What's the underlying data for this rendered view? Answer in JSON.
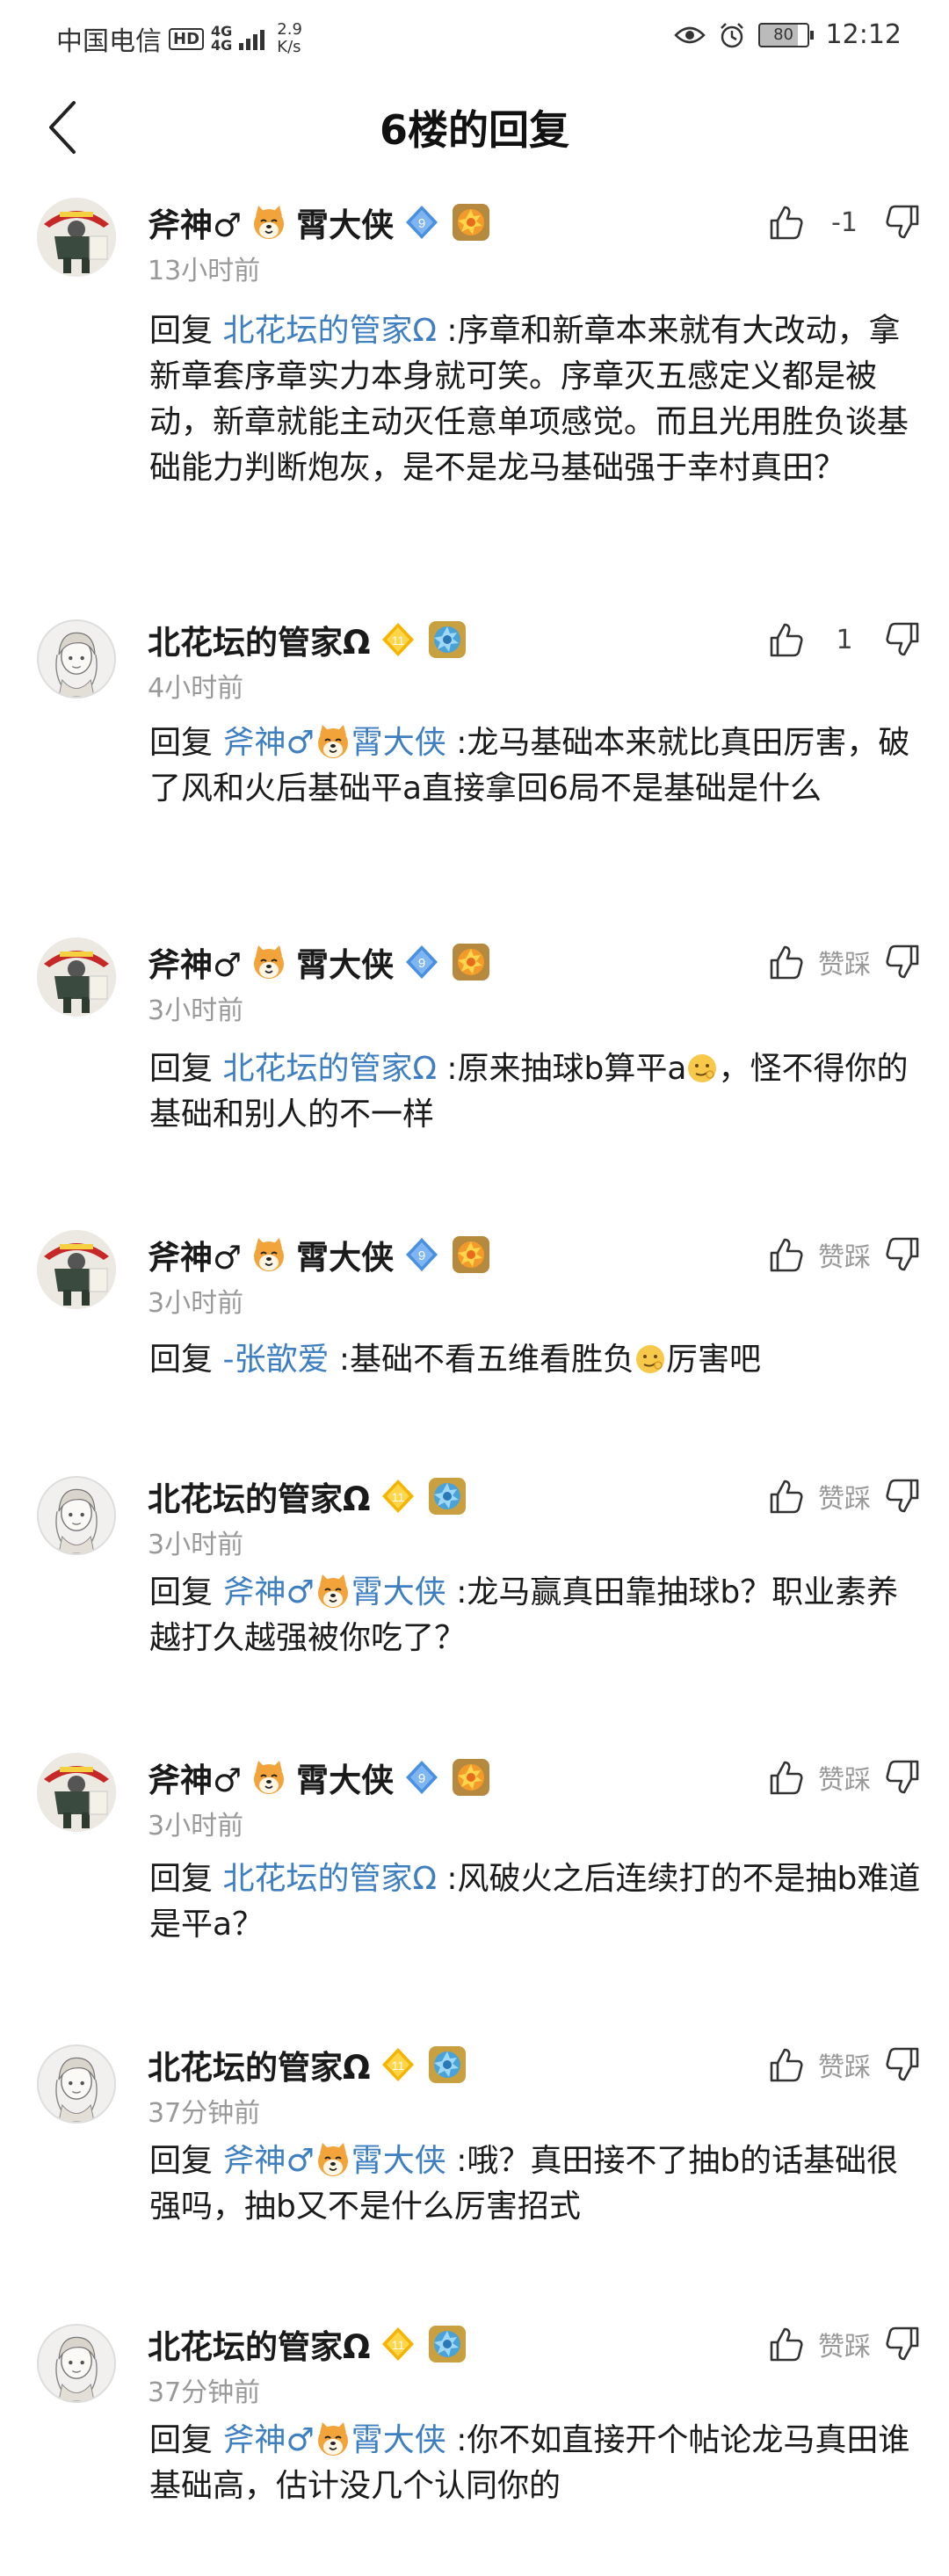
{
  "status_bar": {
    "carrier": "中国电信",
    "hd": "HD",
    "net_top": "4G",
    "net_bottom": "4G",
    "speed_value": "2.9",
    "speed_unit": "K/s",
    "battery": "80",
    "time": "12:12"
  },
  "header": {
    "title": "6楼的回复"
  },
  "users": {
    "fushen": "斧神♂",
    "fushen_tail": "霄大侠",
    "beihua": "北花坛的管家Ω"
  },
  "badges": {
    "blue_level": "9",
    "gold_level": "11"
  },
  "comments": [
    {
      "time": "13小时前",
      "vote_text": "-1",
      "reply_prefix": "回复 ",
      "mention": "北花坛的管家Ω",
      "colon": " :",
      "text": "序章和新章本来就有大改动，拿新章套序章实力本身就可笑。序章灭五感定义都是被动，新章就能主动灭任意单项感觉。而且光用胜负谈基础能力判断炮灰，是不是龙马基础强于幸村真田？"
    },
    {
      "time": "4小时前",
      "vote_text": "1",
      "reply_prefix": "回复 ",
      "mention": "斧神♂",
      "mention_tail": "霄大侠",
      "colon": " :",
      "text": "龙马基础本来就比真田厉害，破了风和火后基础平a直接拿回6局不是基础是什么"
    },
    {
      "time": "3小时前",
      "vote_text": "赞踩",
      "reply_prefix": "回复 ",
      "mention": "北花坛的管家Ω",
      "colon": " :",
      "text": "原来抽球b算平a",
      "text_after": "，怪不得你的基础和别人的不一样"
    },
    {
      "time": "3小时前",
      "vote_text": "赞踩",
      "reply_prefix": "回复 ",
      "mention": "-张歆爱",
      "colon": " :",
      "text": "基础不看五维看胜负",
      "text_after": "厉害吧"
    },
    {
      "time": "3小时前",
      "vote_text": "赞踩",
      "reply_prefix": "回复 ",
      "mention": "斧神♂",
      "mention_tail": "霄大侠",
      "colon": " :",
      "text": "龙马赢真田靠抽球b？职业素养越打久越强被你吃了？"
    },
    {
      "time": "3小时前",
      "vote_text": "赞踩",
      "reply_prefix": "回复 ",
      "mention": "北花坛的管家Ω",
      "colon": " :",
      "text": "风破火之后连续打的不是抽b难道是平a？"
    },
    {
      "time": "37分钟前",
      "vote_text": "赞踩",
      "reply_prefix": "回复 ",
      "mention": "斧神♂",
      "mention_tail": "霄大侠",
      "colon": " :",
      "text": "哦？真田接不了抽b的话基础很强吗，抽b又不是什么厉害招式"
    },
    {
      "time": "37分钟前",
      "vote_text": "赞踩",
      "reply_prefix": "回复 ",
      "mention": "斧神♂",
      "mention_tail": "霄大侠",
      "colon": " :",
      "text": "你不如直接开个帖论龙马真田谁基础高，估计没几个认同你的"
    }
  ]
}
